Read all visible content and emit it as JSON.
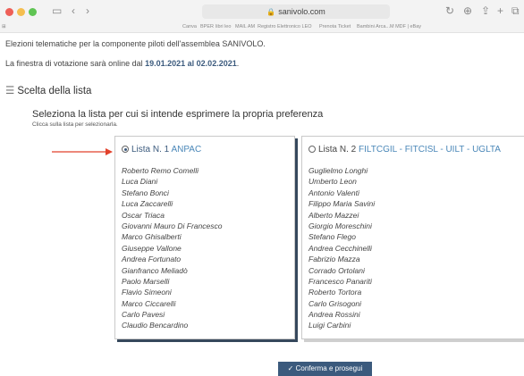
{
  "browser": {
    "url": "sanivolo.com",
    "bookmarks": [
      "Canva",
      "BPER",
      "libri leo",
      "MAIL AM",
      "Registro Elettronico LEO",
      "Prenota Ticket",
      "Bambini Arca...M MDF | eBay"
    ]
  },
  "page": {
    "title": "Elezioni telematiche per la componente piloti dell'assemblea SANIVOLO.",
    "window_prefix": "La finestra di votazione sarà online dal ",
    "date_from": "19.01.2021",
    "window_mid": " al ",
    "date_to": "02.02.2021",
    "window_suffix": ".",
    "section_title": "Scelta della lista",
    "prompt": "Seleziona la lista per cui si intende esprimere la propria preferenza",
    "hint": "Clicca sulla lista per selezionarla."
  },
  "lists": [
    {
      "label": "Lista N. 1 ",
      "org": "ANPAC",
      "selected": true,
      "members": [
        "Roberto Remo Comelli",
        "Luca Diani",
        "Stefano Bonci",
        "Luca Zaccarelli",
        "Oscar Triaca",
        "Giovanni Mauro Di Francesco",
        "Marco Ghisalberti",
        "Giuseppe Vallone",
        "Andrea Fortunato",
        "Gianfranco Meliadò",
        "Paolo Marselli",
        "Flavio Simeoni",
        "Marco Ciccarelli",
        "Carlo Pavesi",
        "Claudio Bencardino"
      ]
    },
    {
      "label": "Lista N. 2 ",
      "org": "FILTCGIL - FITCISL - UILT - UGLTA",
      "selected": false,
      "members": [
        "Guglielmo Longhi",
        "Umberto Leon",
        "Antonio Valenti",
        "Filippo Maria Savini",
        "Alberto Mazzei",
        "Giorgio Moreschini",
        "Stefano Flego",
        "Andrea Cecchinelli",
        "Fabrizio Mazza",
        "Corrado Ortolani",
        "Francesco Panariti",
        "Roberto Tortora",
        "Carlo Grisogoni",
        "Andrea Rossini",
        "Luigi Carbini"
      ]
    }
  ],
  "confirm_label": "✓ Conferma e prosegui",
  "colors": {
    "accent": "#3b5a7d",
    "arrow": "#e2412b",
    "org": "#4a87b8"
  }
}
